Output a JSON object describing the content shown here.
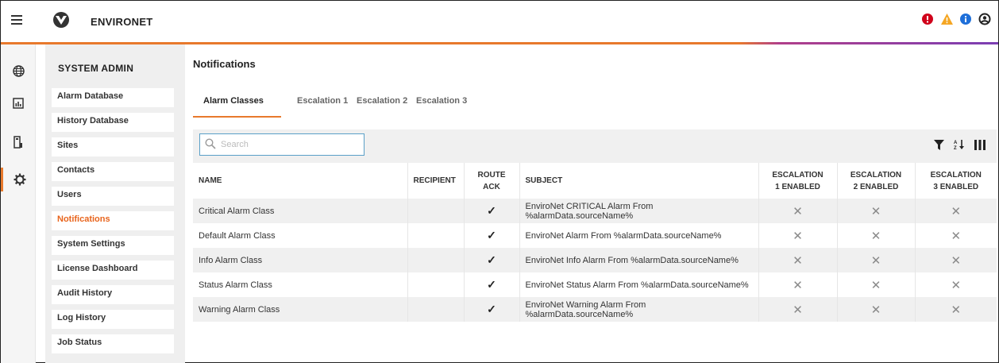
{
  "app": {
    "brand": "ENVIRONET"
  },
  "header": {
    "status_icons": [
      {
        "name": "critical-alert-icon",
        "color": "#d0021b"
      },
      {
        "name": "warning-alert-icon",
        "color": "#f5a623"
      },
      {
        "name": "info-alert-icon",
        "color": "#1e6fd9"
      },
      {
        "name": "user-account-icon",
        "color": "#222222"
      }
    ]
  },
  "rail": {
    "items": [
      {
        "icon": "globe-icon"
      },
      {
        "icon": "report-chart-icon"
      },
      {
        "icon": "device-icon"
      },
      {
        "icon": "gear-icon",
        "active": true
      }
    ]
  },
  "sidebar": {
    "header": "SYSTEM ADMIN",
    "items": [
      {
        "label": "Alarm Database"
      },
      {
        "label": "History Database"
      },
      {
        "label": "Sites"
      },
      {
        "label": "Contacts"
      },
      {
        "label": "Users"
      },
      {
        "label": "Notifications",
        "active": true
      },
      {
        "label": "System Settings"
      },
      {
        "label": "License Dashboard"
      },
      {
        "label": "Audit History"
      },
      {
        "label": "Log History"
      },
      {
        "label": "Job Status"
      }
    ]
  },
  "main": {
    "title": "Notifications",
    "tabs": [
      {
        "label": "Alarm Classes",
        "active": true
      },
      {
        "label": "Escalation 1"
      },
      {
        "label": "Escalation 2"
      },
      {
        "label": "Escalation 3"
      }
    ],
    "search": {
      "placeholder": "Search",
      "value": ""
    },
    "toolbar_icons": [
      "filter-icon",
      "sort-icon",
      "columns-icon"
    ],
    "table": {
      "columns": [
        {
          "label": "NAME"
        },
        {
          "label": "RECIPIENT"
        },
        {
          "label": "ROUTE\nACK"
        },
        {
          "label": "SUBJECT"
        },
        {
          "label": "ESCALATION\n1 ENABLED"
        },
        {
          "label": "ESCALATION\n2 ENABLED"
        },
        {
          "label": "ESCALATION\n3 ENABLED"
        }
      ],
      "rows": [
        {
          "name": "Critical Alarm Class",
          "recipient": "",
          "route_ack": "✓",
          "subject": "EnviroNet CRITICAL Alarm From %alarmData.sourceName%",
          "esc1": "✕",
          "esc2": "✕",
          "esc3": "✕"
        },
        {
          "name": "Default Alarm Class",
          "recipient": "",
          "route_ack": "✓",
          "subject": "EnviroNet Alarm From %alarmData.sourceName%",
          "esc1": "✕",
          "esc2": "✕",
          "esc3": "✕"
        },
        {
          "name": "Info Alarm Class",
          "recipient": "",
          "route_ack": "✓",
          "subject": "EnviroNet Info Alarm From %alarmData.sourceName%",
          "esc1": "✕",
          "esc2": "✕",
          "esc3": "✕"
        },
        {
          "name": "Status Alarm Class",
          "recipient": "",
          "route_ack": "✓",
          "subject": "EnviroNet Status Alarm From %alarmData.sourceName%",
          "esc1": "✕",
          "esc2": "✕",
          "esc3": "✕"
        },
        {
          "name": "Warning Alarm Class",
          "recipient": "",
          "route_ack": "✓",
          "subject": "EnviroNet Warning Alarm From %alarmData.sourceName%",
          "esc1": "✕",
          "esc2": "✕",
          "esc3": "✕"
        }
      ]
    }
  },
  "colors": {
    "accent": "#e8792c",
    "active_nav_text": "#e8641c",
    "search_border": "#5aa0c8"
  }
}
